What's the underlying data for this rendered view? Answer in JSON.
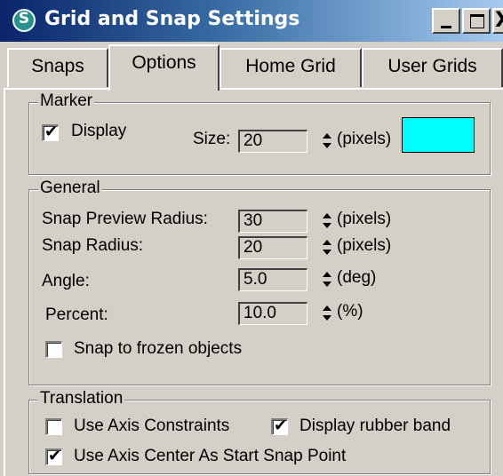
{
  "window": {
    "title": "Grid and Snap Settings",
    "close_label": "X"
  },
  "tabs": [
    {
      "label": "Snaps",
      "active": false
    },
    {
      "label": "Options",
      "active": true
    },
    {
      "label": "Home Grid",
      "active": false
    },
    {
      "label": "User Grids",
      "active": false
    }
  ],
  "marker": {
    "legend": "Marker",
    "display_label": "Display",
    "display_checked": true,
    "size_label": "Size:",
    "size_value": "20",
    "size_unit": "(pixels)",
    "color": "#00ffff"
  },
  "general": {
    "legend": "General",
    "preview_radius_label": "Snap Preview Radius:",
    "preview_radius_value": "30",
    "preview_radius_unit": "(pixels)",
    "snap_radius_label": "Snap Radius:",
    "snap_radius_value": "20",
    "snap_radius_unit": "(pixels)",
    "angle_label": "Angle:",
    "angle_value": "5.0",
    "angle_unit": "(deg)",
    "percent_label": "Percent:",
    "percent_value": "10.0",
    "percent_unit": "(%)",
    "frozen_label": "Snap to frozen objects",
    "frozen_checked": false
  },
  "translation": {
    "legend": "Translation",
    "axis_constraints_label": "Use Axis Constraints",
    "axis_constraints_checked": false,
    "rubber_band_label": "Display rubber band",
    "rubber_band_checked": true,
    "axis_center_label": "Use Axis Center As Start Snap Point",
    "axis_center_checked": true
  }
}
